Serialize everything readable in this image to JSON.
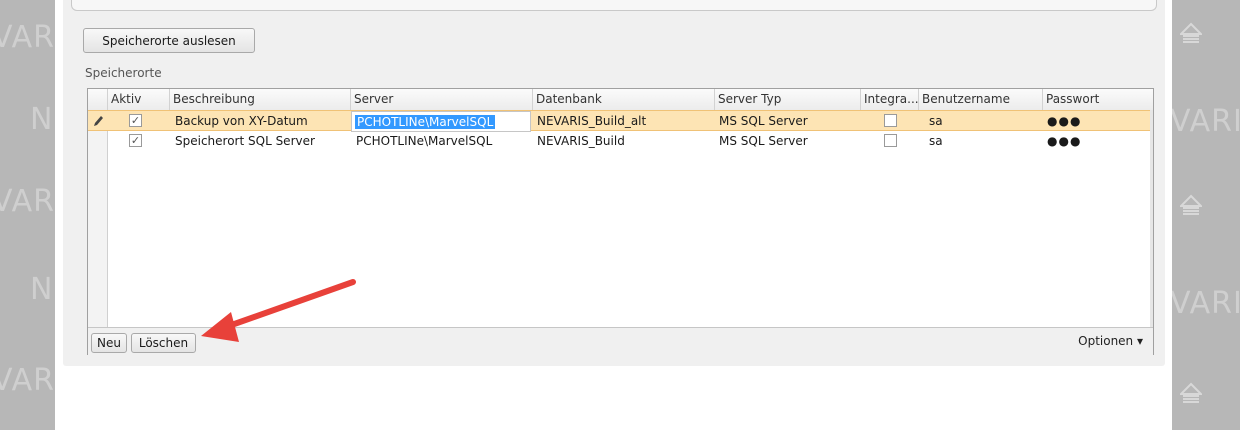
{
  "toolbar": {
    "read_button": "Speicherorte auslesen"
  },
  "section": {
    "label": "Speicherorte"
  },
  "grid": {
    "headers": [
      "Aktiv",
      "Beschreibung",
      "Server",
      "Datenbank",
      "Server Typ",
      "Integra...",
      "Benutzername",
      "Passwort"
    ],
    "rows": [
      {
        "aktiv": true,
        "beschreibung": "Backup von XY-Datum",
        "server": "PCHOTLINe\\MarvelSQL",
        "datenbank": "NEVARIS_Build_alt",
        "typ": "MS SQL Server",
        "integrated": false,
        "user": "sa",
        "password": "●●●"
      },
      {
        "aktiv": true,
        "beschreibung": "Speicherort SQL Server",
        "server": "PCHOTLINe\\MarvelSQL",
        "datenbank": "NEVARIS_Build",
        "typ": "MS SQL Server",
        "integrated": false,
        "user": "sa",
        "password": "●●●"
      }
    ]
  },
  "footer": {
    "new_button": "Neu",
    "delete_button": "Löschen",
    "options_label": "Optionen ▾"
  },
  "watermark": {
    "text_left_a": "VAR",
    "text_left_b": "N",
    "text_right_a": "VAR",
    "text_right_b": "VARI"
  },
  "colors": {
    "selected_row": "#fde4b4",
    "text_highlight": "#3399ff",
    "arrow": "#e8413a"
  }
}
